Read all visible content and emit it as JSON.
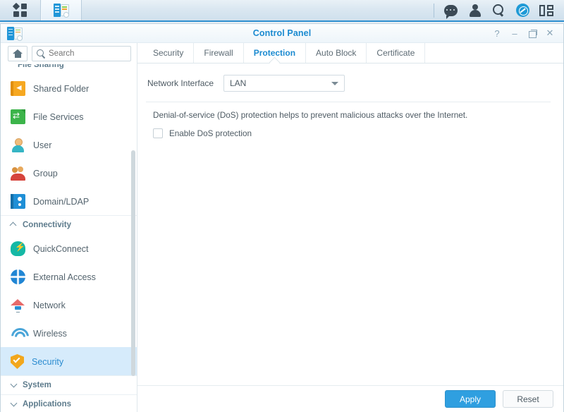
{
  "taskbar": {
    "left_buttons": [
      {
        "name": "main-menu",
        "icon": "grid-menu-icon"
      },
      {
        "name": "control-panel-task",
        "icon": "control-panel-icon",
        "active": true
      }
    ],
    "right_icons": [
      {
        "name": "notifications-chat",
        "icon": "chat-bubble-icon"
      },
      {
        "name": "user-options",
        "icon": "person-icon"
      },
      {
        "name": "search",
        "icon": "search-icon"
      },
      {
        "name": "update-notification",
        "icon": "blue-circle-check-icon"
      },
      {
        "name": "widgets",
        "icon": "widgets-panel-icon"
      }
    ]
  },
  "window": {
    "title": "Control Panel",
    "controls": {
      "help": "?",
      "minimize": "–",
      "restore": "restore-icon",
      "close": "✕"
    }
  },
  "sidebar": {
    "home_tooltip": "Home",
    "search": {
      "placeholder": "Search",
      "value": ""
    },
    "cut_group_label": "File Sharing",
    "items": [
      {
        "label": "Shared Folder",
        "icon": "shared-folder-icon",
        "type": "item",
        "selected": false
      },
      {
        "label": "File Services",
        "icon": "file-services-icon",
        "type": "item",
        "selected": false
      },
      {
        "label": "User",
        "icon": "user-icon",
        "type": "item",
        "selected": false
      },
      {
        "label": "Group",
        "icon": "group-icon",
        "type": "item",
        "selected": false
      },
      {
        "label": "Domain/LDAP",
        "icon": "domain-ldap-icon",
        "type": "item",
        "selected": false
      },
      {
        "label": "Connectivity",
        "type": "group",
        "expanded": true
      },
      {
        "label": "QuickConnect",
        "icon": "quickconnect-icon",
        "type": "item",
        "selected": false
      },
      {
        "label": "External Access",
        "icon": "globe-icon",
        "type": "item",
        "selected": false
      },
      {
        "label": "Network",
        "icon": "network-icon",
        "type": "item",
        "selected": false
      },
      {
        "label": "Wireless",
        "icon": "wireless-icon",
        "type": "item",
        "selected": false
      },
      {
        "label": "Security",
        "icon": "security-shield-icon",
        "type": "item",
        "selected": true
      },
      {
        "label": "System",
        "type": "group",
        "expanded": false
      },
      {
        "label": "Applications",
        "type": "group",
        "expanded": false
      }
    ]
  },
  "main": {
    "tabs": [
      {
        "label": "Security",
        "active": false
      },
      {
        "label": "Firewall",
        "active": false
      },
      {
        "label": "Protection",
        "active": true
      },
      {
        "label": "Auto Block",
        "active": false
      },
      {
        "label": "Certificate",
        "active": false
      }
    ],
    "network_interface": {
      "label": "Network Interface",
      "value": "LAN",
      "options": [
        "LAN"
      ]
    },
    "description": "Denial-of-service (DoS) protection helps to prevent malicious attacks over the Internet.",
    "dos_checkbox": {
      "label": "Enable DoS protection",
      "checked": false
    },
    "buttons": {
      "apply": "Apply",
      "reset": "Reset"
    }
  },
  "colors": {
    "accent": "#1b8ad0",
    "primary_button": "#2f9fe0",
    "selected_item_bg": "#d6ebfb",
    "taskbar_border": "#2f8fd0"
  }
}
